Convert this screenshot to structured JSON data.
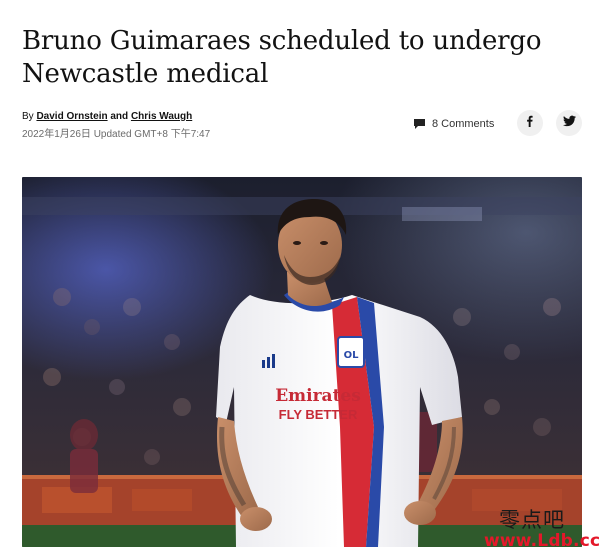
{
  "article": {
    "headline": "Bruno Guimaraes scheduled to undergo Newcastle medical",
    "byline_prefix": "By",
    "author1": "David Ornstein",
    "byline_and": "and",
    "author2": "Chris Waugh",
    "dateline": "2022年1月26日 Updated GMT+8 下午7:47"
  },
  "actions": {
    "comment_icon": "comment-icon",
    "comments_label": "8 Comments",
    "facebook_icon": "facebook-icon",
    "twitter_icon": "twitter-icon"
  },
  "hero": {
    "shirt_sponsor_line1": "Emirates",
    "shirt_sponsor_line2": "FLY BETTER",
    "crest": "OL"
  },
  "watermark": {
    "chinese": "零点吧",
    "url": "www.Ldb.cc"
  },
  "colors": {
    "text": "#121212",
    "muted": "#6b6b6b",
    "shirt_red": "#d62b36",
    "shirt_blue": "#2a4aa8",
    "watermark_red": "#e4182a"
  }
}
